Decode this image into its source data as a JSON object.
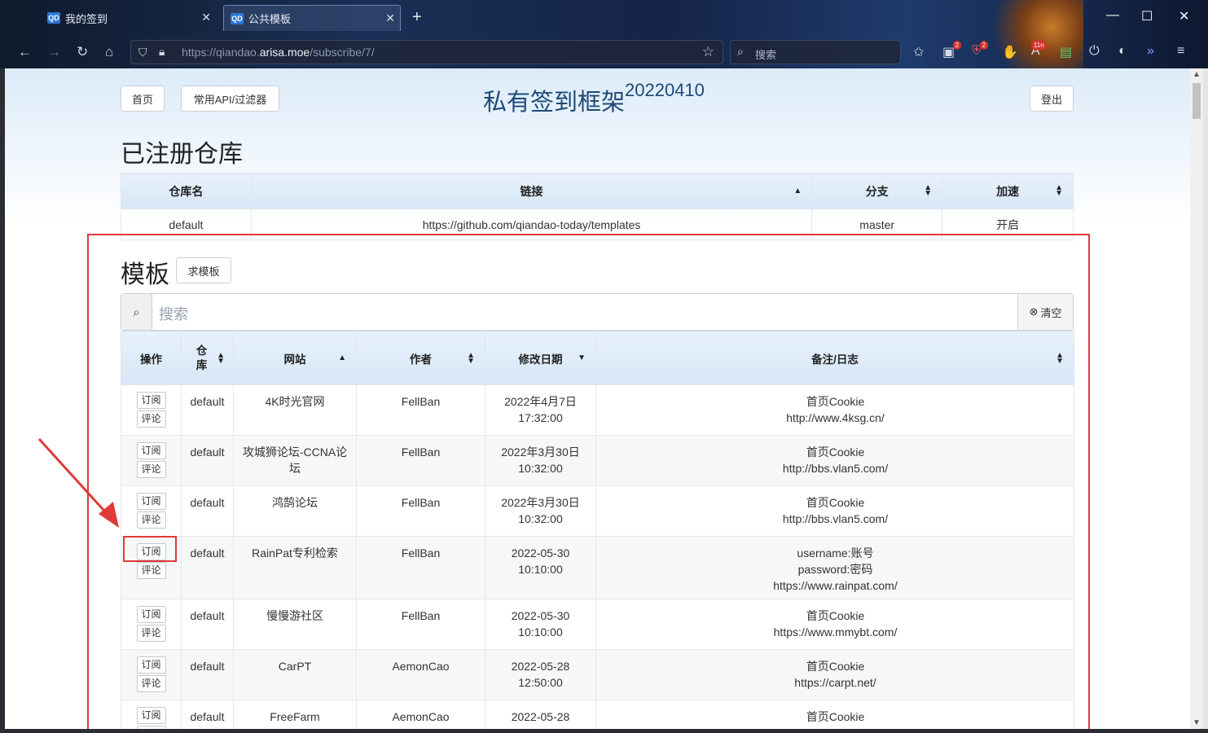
{
  "browser": {
    "tabs": [
      {
        "label": "我的签到",
        "icon": "QD"
      },
      {
        "label": "公共模板",
        "icon": "QD"
      }
    ],
    "url_prefix": "https://qiandao.",
    "url_domain": "arisa.moe",
    "url_path": "/subscribe/7/",
    "search_placeholder": "搜索",
    "badges": {
      "ext1": "2",
      "ext2": "2",
      "ext3": "11n"
    }
  },
  "header": {
    "home_label": "首页",
    "api_label": "常用API/过滤器",
    "title": "私有签到框架",
    "version": "20220410",
    "logout_label": "登出"
  },
  "repos": {
    "heading": "已注册仓库",
    "columns": [
      "仓库名",
      "链接",
      "分支",
      "加速"
    ],
    "rows": [
      {
        "name": "default",
        "link": "https://github.com/qiandao-today/templates",
        "branch": "master",
        "accel": "开启"
      }
    ]
  },
  "templates": {
    "heading": "模板",
    "request_label": "求模板",
    "search_placeholder": "搜索",
    "clear_label": "清空",
    "columns": [
      "操作",
      "仓库",
      "网站",
      "作者",
      "修改日期",
      "备注/日志"
    ],
    "subscribe_label": "订阅",
    "comment_label": "评论",
    "rows": [
      {
        "repo": "default",
        "site": "4K时光官网",
        "author": "FellBan",
        "date1": "2022年4月7日",
        "date2": "17:32:00",
        "note": [
          "首页Cookie",
          "http://www.4ksg.cn/"
        ]
      },
      {
        "repo": "default",
        "site": "攻城狮论坛-CCNA论坛",
        "author": "FellBan",
        "date1": "2022年3月30日",
        "date2": "10:32:00",
        "note": [
          "首页Cookie",
          "http://bbs.vlan5.com/"
        ]
      },
      {
        "repo": "default",
        "site": "鸿鹄论坛",
        "author": "FellBan",
        "date1": "2022年3月30日",
        "date2": "10:32:00",
        "note": [
          "首页Cookie",
          "http://bbs.vlan5.com/"
        ]
      },
      {
        "repo": "default",
        "site": "RainPat专利检索",
        "author": "FellBan",
        "date1": "2022-05-30",
        "date2": "10:10:00",
        "note": [
          "username:账号",
          "password:密码",
          "https://www.rainpat.com/"
        ]
      },
      {
        "repo": "default",
        "site": "慢慢游社区",
        "author": "FellBan",
        "date1": "2022-05-30",
        "date2": "10:10:00",
        "note": [
          "首页Cookie",
          "https://www.mmybt.com/"
        ]
      },
      {
        "repo": "default",
        "site": "CarPT",
        "author": "AemonCao",
        "date1": "2022-05-28",
        "date2": "12:50:00",
        "note": [
          "首页Cookie",
          "https://carpt.net/"
        ]
      },
      {
        "repo": "default",
        "site": "FreeFarm",
        "author": "AemonCao",
        "date1": "2022-05-28",
        "date2": "",
        "note": [
          "首页Cookie"
        ]
      }
    ]
  },
  "colors": {
    "annotation": "#e03a3a",
    "title": "#1e4a77",
    "link": "#2a5a88"
  }
}
